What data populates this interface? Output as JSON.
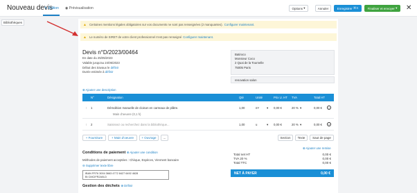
{
  "header": {
    "title": "Nouveau devis",
    "tabs": [
      {
        "label": "Édition",
        "icon": "pencil-icon"
      },
      {
        "label": "Prévisualisation",
        "icon": "eye-icon"
      }
    ],
    "options_label": "Options",
    "cancel_label": "Annuler",
    "save_label": "Enregistrer",
    "save_shortcut": "⌘S",
    "finalize_label": "Finaliser et envoyer",
    "close_glyph": "✕"
  },
  "sidebar": {
    "library_label": "Bibliothèques"
  },
  "warnings": [
    {
      "text": "Certaines mentions légales obligatoires sur vos documents ne sont pas renseignées (2 manquantes).",
      "link": "Configurer maintenant."
    },
    {
      "text": "Le numéro de SIRET de votre client professionnel n'est pas renseigné",
      "link": "Configurer maintenant."
    }
  ],
  "quote": {
    "title": "Devis n°D/2023/00464",
    "date_line": "En date du 25/05/2023",
    "validity_line": "Valable jusqu'au 24/06/2023",
    "start_label": "Début des travaux le",
    "start_link": "définir",
    "duration_label": "Durée estimée à",
    "duration_link": "définir",
    "add_description": "Ajouter une description"
  },
  "client": {
    "name": "Batiroco",
    "contact": "Monsieur Coco",
    "street": "2 Quai de la Tournelle",
    "city": "75005 Paris",
    "subtitle": "renovation salon"
  },
  "table": {
    "headers": [
      "N°",
      "Désignation",
      "Qté",
      "Unité",
      "Prix U. HT",
      "TVA",
      "Total HT"
    ],
    "rows": [
      {
        "num": "1",
        "designation": "Démolition manuelle de cloison en carreaux de plâtre.",
        "sub": "Main d'oeuvre (0,1 h)",
        "qty": "1,00",
        "unit": "m²",
        "price": "0,00 €",
        "tva": "20 %",
        "total": "0,00 €"
      },
      {
        "num": "2",
        "designation": "Saisissez ou recherchez dans la bibliothèque...",
        "sub": "",
        "qty": "1,00",
        "unit": "u",
        "price": "0,00 €",
        "tva": "20 %",
        "total": "0,00 €"
      }
    ]
  },
  "add_buttons": [
    "+ Fourniture",
    "+ Main d'oeuvre",
    "+ Ouvrage",
    "..."
  ],
  "section_buttons": [
    "Section",
    "Texte",
    "Saut de page"
  ],
  "add_discount": "Ajouter une remise",
  "payment": {
    "title": "Conditions de paiement",
    "add_condition": "Ajouter une condition",
    "methods": "Méthodes de paiement acceptées : Chèque, Espèces, Virement bancaire",
    "remove_text": "Supprimer texte libre",
    "iban": "IBAN FR76 3004 3663 4772 8427 6492 4628",
    "bic": "BI CMCIFR2A0LD"
  },
  "waste": {
    "title": "Gestion des déchets",
    "link": "Définir"
  },
  "totals": {
    "rows": [
      {
        "label": "Total net HT",
        "value": "0,00 €"
      },
      {
        "label": "TVA 20 %",
        "value": "0,00 €"
      },
      {
        "label": "Total TTC",
        "value": "0,00 €"
      }
    ],
    "net_label": "NET À PAYER",
    "net_value": "0,00 €"
  },
  "colors": {
    "accent": "#1a8fd6",
    "green": "#3fa33f",
    "warning_bg": "#fdf6d8",
    "arrow": "#d32f2f"
  }
}
